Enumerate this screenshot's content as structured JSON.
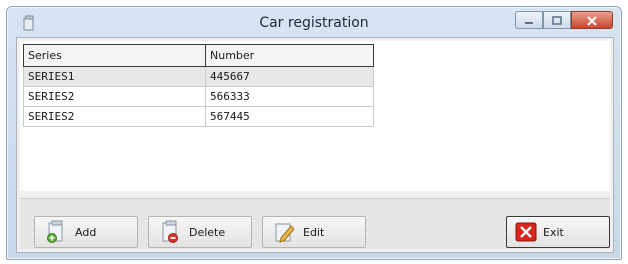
{
  "window": {
    "title": "Car registration",
    "icon": "document-icon"
  },
  "grid": {
    "columns": [
      "Series",
      "Number"
    ],
    "rows": [
      {
        "series": "SERIES1",
        "number": "445667"
      },
      {
        "series": "SERIES2",
        "number": "566333"
      },
      {
        "series": "SERIES2",
        "number": "567445"
      }
    ]
  },
  "buttons": {
    "add": {
      "label": "Add",
      "icon": "add-document-icon"
    },
    "delete": {
      "label": "Delete",
      "icon": "delete-document-icon"
    },
    "edit": {
      "label": "Edit",
      "icon": "edit-document-icon"
    },
    "exit": {
      "label": "Exit",
      "icon": "exit-x-icon"
    }
  },
  "colors": {
    "title_bar": "#d7e4f2",
    "close_button": "#c8452c",
    "exit_icon": "#d9261c"
  }
}
